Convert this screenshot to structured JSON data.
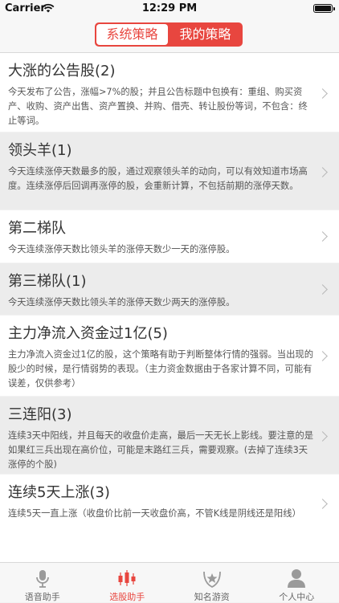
{
  "status_bar": {
    "carrier": "Carrier",
    "time": "12:29 PM"
  },
  "header": {
    "tabs": [
      "系统策略",
      "我的策略"
    ],
    "active_tab": 0
  },
  "colors": {
    "accent": "#e8463f",
    "tab_inactive": "#888888"
  },
  "strategies": [
    {
      "title": "大涨的公告股(2)",
      "desc": "今天发布了公告，涨幅>7%的股；并且公告标题中包换有：重组、购买资产、收购、资产出售、资产置换、并购、借壳、转让股份等词，不包含：终止等词。"
    },
    {
      "title": "领头羊(1)",
      "desc": "今天连续涨停天数最多的股，通过观察领头羊的动向，可以有效知道市场高度。连续涨停后回调再涨停的股，会重新计算，不包括前期的涨停天数。"
    },
    {
      "title": "第二梯队",
      "desc": "今天连续涨停天数比领头羊的涨停天数少一天的涨停股。"
    },
    {
      "title": "第三梯队(1)",
      "desc": "今天连续涨停天数比领头羊的涨停天数少两天的涨停股。"
    },
    {
      "title": "主力净流入资金过1亿(5)",
      "desc": "主力净流入资金过1亿的股，这个策略有助于判断整体行情的强弱。当出现的股少的时候，是行情弱势的表现。（主力资金数据由于各家计算不同，可能有误差，仅供参考）"
    },
    {
      "title": "三连阳(3)",
      "desc": "连续3天中阳线，并且每天的收盘价走高，最后一天无长上影线。要注意的是如果红三兵出现在高价位，可能是末路红三兵，需要观察。(去掉了连续3天涨停的个股)"
    },
    {
      "title": "连续5天上涨(3)",
      "desc": "连续5天一直上涨（收盘价比前一天收盘价高，不管K线是阴线还是阳线）"
    }
  ],
  "tab_bar": [
    {
      "label": "语音助手",
      "icon": "microphone-icon"
    },
    {
      "label": "选股助手",
      "icon": "candlestick-chart-icon"
    },
    {
      "label": "知名游资",
      "icon": "star-badge-icon"
    },
    {
      "label": "个人中心",
      "icon": "person-icon"
    }
  ],
  "active_tab_index": 1
}
